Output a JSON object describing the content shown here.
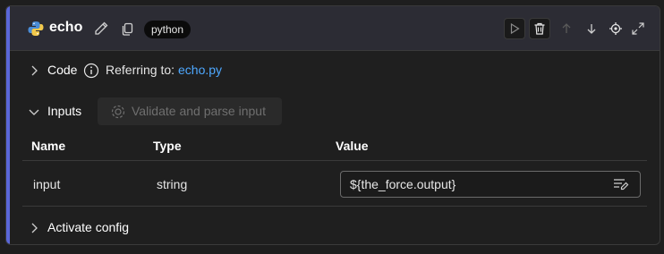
{
  "header": {
    "title": "echo",
    "badge": "python"
  },
  "code": {
    "label": "Code",
    "referring_prefix": "Referring to:",
    "file_link": "echo.py"
  },
  "inputs": {
    "label": "Inputs",
    "validate_label": "Validate and parse input",
    "columns": [
      "Name",
      "Type",
      "Value"
    ],
    "rows": [
      {
        "name": "input",
        "type": "string",
        "value": "${the_force.output}"
      }
    ]
  },
  "activate": {
    "label": "Activate config"
  },
  "colors": {
    "accent": "#5a67d8",
    "link": "#4ea8ff",
    "header_bg": "#2c2c34"
  }
}
